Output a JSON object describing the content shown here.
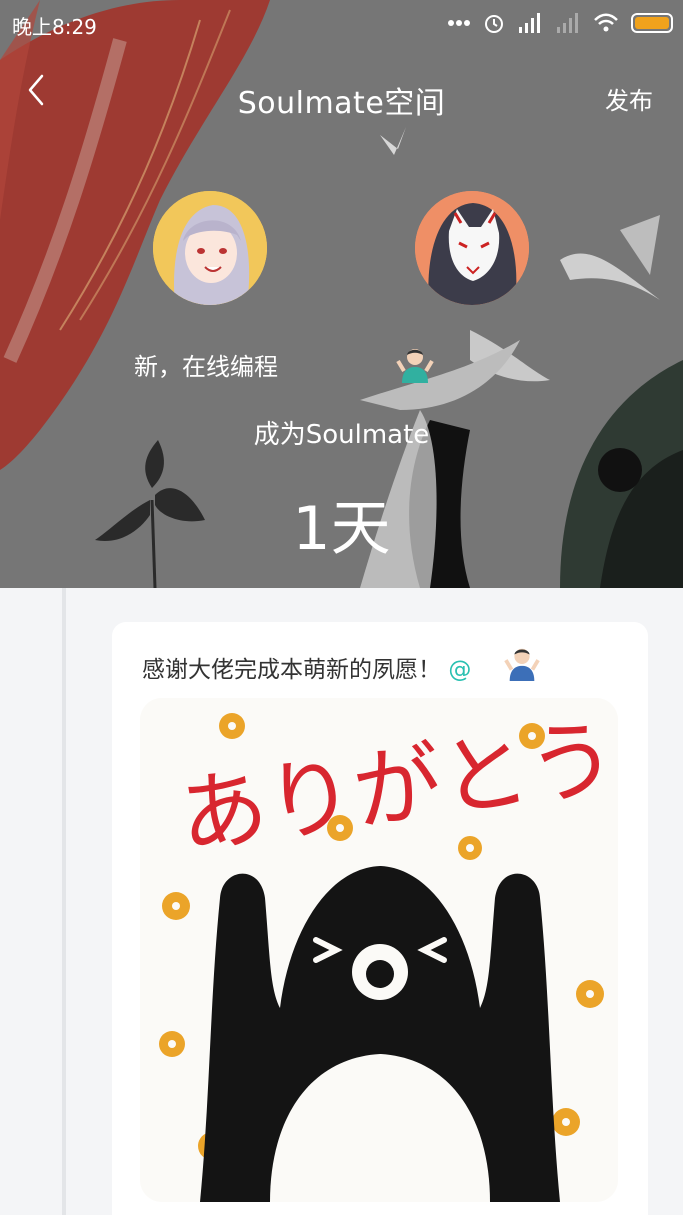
{
  "status_bar": {
    "time": "晚上8:29"
  },
  "nav": {
    "title": "Soulmate空间",
    "publish_label": "发布"
  },
  "hero": {
    "ticker_text": "新，在线编程",
    "become_label": "成为Soulmate",
    "days_value": "1天"
  },
  "post": {
    "text": "感谢大佬完成本萌新的夙愿！",
    "mention": "@",
    "image_text": "ありがとう!"
  },
  "colors": {
    "accent_mention": "#29c0b1",
    "battery": "#f0a21c",
    "sticker_red": "#d8262f",
    "sticker_flower": "#eba429"
  }
}
